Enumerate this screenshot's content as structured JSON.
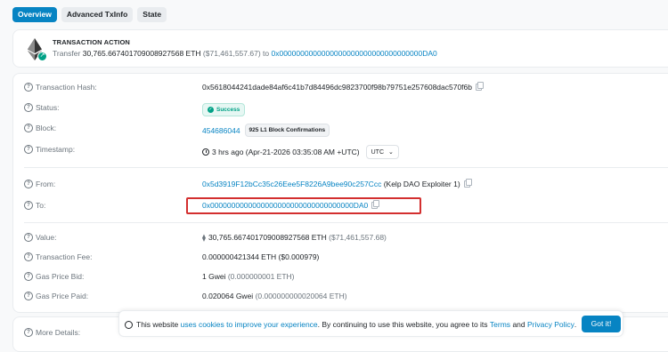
{
  "tabs": [
    "Overview",
    "Advanced TxInfo",
    "State"
  ],
  "action": {
    "title": "TRANSACTION ACTION",
    "prefix": "Transfer",
    "amount": "30,765.667401709008927568 ETH",
    "usd": "($71,461,557.67)",
    "to_word": "to",
    "to_address": "0x0000000000000000000000000000000000DA0"
  },
  "details": {
    "hash": {
      "label": "Transaction Hash:",
      "value": "0x5618044241dade84af6c41b7d84496dc9823700f98b79751e257608dac570f6b"
    },
    "status": {
      "label": "Status:",
      "value": "Success"
    },
    "block": {
      "label": "Block:",
      "value": "454686044",
      "confirmations": "925 L1 Block Confirmations"
    },
    "timestamp": {
      "label": "Timestamp:",
      "value": "3 hrs ago (Apr-21-2026 03:35:08 AM +UTC)",
      "zone": "UTC"
    },
    "from": {
      "label": "From:",
      "address": "0x5d3919F12bCc35c26Eee5F8226A9bee90c257Ccc",
      "name": "(Kelp DAO Exploiter 1)"
    },
    "to": {
      "label": "To:",
      "address": "0x0000000000000000000000000000000000DA0"
    },
    "value": {
      "label": "Value:",
      "amount": "30,765.667401709008927568 ETH",
      "usd": "($71,461,557.68)"
    },
    "fee": {
      "label": "Transaction Fee:",
      "value": "0.000000421344 ETH ($0.000979)"
    },
    "gas_bid": {
      "label": "Gas Price Bid:",
      "value": "1 Gwei",
      "eth": "(0.000000001 ETH)"
    },
    "gas_paid": {
      "label": "Gas Price Paid:",
      "value": "0.020064 Gwei",
      "eth": "(0.000000000020064 ETH)"
    }
  },
  "more_details": "More Details:",
  "cookie": {
    "pre": "This website",
    "link1": "uses cookies to improve your experience",
    "mid": ". By continuing to use this website, you agree to its",
    "link2": "Terms",
    "and": "and",
    "link3": "Privacy Policy",
    "end": ".",
    "button": "Got it!"
  },
  "colors": {
    "accent": "#0784c3",
    "success": "#00a186",
    "highlight": "#d32f2f"
  }
}
